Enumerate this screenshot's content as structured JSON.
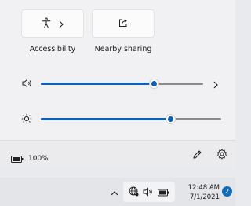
{
  "quick_settings": {
    "tiles": [
      {
        "label": "Accessibility",
        "icon": "accessibility-icon",
        "has_chevron": true
      },
      {
        "label": "Nearby sharing",
        "icon": "share-icon",
        "has_chevron": false
      }
    ],
    "volume": {
      "icon": "speaker-icon",
      "level_percent": 70
    },
    "brightness": {
      "icon": "brightness-icon",
      "level_percent": 72
    }
  },
  "footer": {
    "battery_text": "100%",
    "edit_icon": "pencil-icon",
    "settings_icon": "gear-icon"
  },
  "taskbar": {
    "time": "12:48 AM",
    "date": "7/1/2021",
    "notification_count": "2"
  },
  "colors": {
    "accent": "#0f5fb5",
    "badge": "#0f6cbd"
  }
}
